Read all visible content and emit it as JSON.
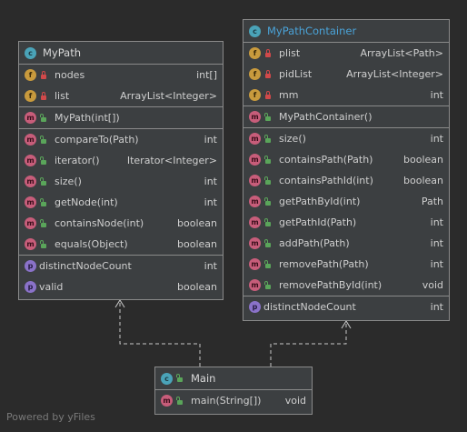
{
  "classes": {
    "mypath": {
      "name": "MyPath",
      "fields": [
        {
          "name": "nodes",
          "type": "int[]"
        },
        {
          "name": "list",
          "type": "ArrayList<Integer>"
        }
      ],
      "constructors": [
        {
          "name": "MyPath(int[])",
          "type": ""
        }
      ],
      "methods": [
        {
          "name": "compareTo(Path)",
          "type": "int"
        },
        {
          "name": "iterator()",
          "type": "Iterator<Integer>"
        },
        {
          "name": "size()",
          "type": "int"
        },
        {
          "name": "getNode(int)",
          "type": "int"
        },
        {
          "name": "containsNode(int)",
          "type": "boolean"
        },
        {
          "name": "equals(Object)",
          "type": "boolean"
        }
      ],
      "properties": [
        {
          "name": "distinctNodeCount",
          "type": "int"
        },
        {
          "name": "valid",
          "type": "boolean"
        }
      ]
    },
    "mypathcontainer": {
      "name": "MyPathContainer",
      "fields": [
        {
          "name": "plist",
          "type": "ArrayList<Path>"
        },
        {
          "name": "pidList",
          "type": "ArrayList<Integer>"
        },
        {
          "name": "mm",
          "type": "int"
        }
      ],
      "constructors": [
        {
          "name": "MyPathContainer()",
          "type": ""
        }
      ],
      "methods": [
        {
          "name": "size()",
          "type": "int"
        },
        {
          "name": "containsPath(Path)",
          "type": "boolean"
        },
        {
          "name": "containsPathId(int)",
          "type": "boolean"
        },
        {
          "name": "getPathById(int)",
          "type": "Path"
        },
        {
          "name": "getPathId(Path)",
          "type": "int"
        },
        {
          "name": "addPath(Path)",
          "type": "int"
        },
        {
          "name": "removePath(Path)",
          "type": "int"
        },
        {
          "name": "removePathById(int)",
          "type": "void"
        }
      ],
      "properties": [
        {
          "name": "distinctNodeCount",
          "type": "int"
        }
      ]
    },
    "main": {
      "name": "Main",
      "methods": [
        {
          "name": "main(String[])",
          "type": "void"
        }
      ]
    }
  },
  "badges": {
    "class": "c",
    "field": "f",
    "method": "m",
    "property": "p"
  },
  "footer": "Powered by yFiles",
  "colors": {
    "background": "#2b2b2b",
    "box": "#3c3f41",
    "border": "#8a8a8a",
    "selected_title": "#4aa3d8",
    "edge": "#c8c8c8"
  }
}
